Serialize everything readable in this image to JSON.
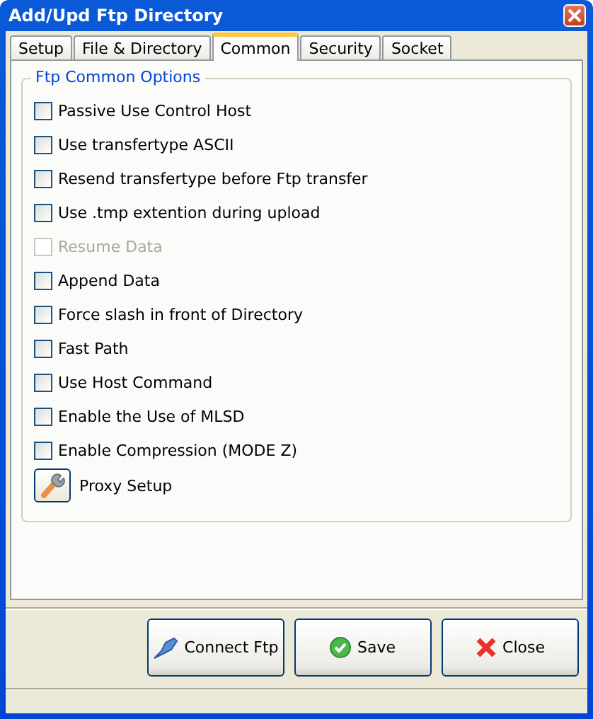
{
  "window": {
    "title": "Add/Upd Ftp Directory"
  },
  "tabs": [
    {
      "label": "Setup",
      "selected": false
    },
    {
      "label": "File & Directory",
      "selected": false
    },
    {
      "label": "Common",
      "selected": true
    },
    {
      "label": "Security",
      "selected": false
    },
    {
      "label": "Socket",
      "selected": false
    }
  ],
  "group": {
    "title": "Ftp Common Options",
    "options": [
      {
        "label": "Passive Use Control Host",
        "checked": false,
        "disabled": false
      },
      {
        "label": "Use transfertype ASCII",
        "checked": false,
        "disabled": false
      },
      {
        "label": "Resend transfertype before Ftp transfer",
        "checked": false,
        "disabled": false
      },
      {
        "label": "Use .tmp extention during upload",
        "checked": false,
        "disabled": false
      },
      {
        "label": "Resume Data",
        "checked": false,
        "disabled": true
      },
      {
        "label": "Append Data",
        "checked": false,
        "disabled": false
      },
      {
        "label": "Force slash in front of Directory",
        "checked": false,
        "disabled": false
      },
      {
        "label": "Fast Path",
        "checked": false,
        "disabled": false
      },
      {
        "label": "Use Host Command",
        "checked": false,
        "disabled": false
      },
      {
        "label": "Enable the Use of MLSD",
        "checked": false,
        "disabled": false
      },
      {
        "label": "Enable Compression (MODE Z)",
        "checked": false,
        "disabled": false
      }
    ],
    "proxy_button": {
      "label": "Proxy Setup"
    }
  },
  "buttons": [
    {
      "kind": "connect",
      "label": "Connect Ftp"
    },
    {
      "kind": "save",
      "label": "Save"
    },
    {
      "kind": "close",
      "label": "Close"
    }
  ]
}
